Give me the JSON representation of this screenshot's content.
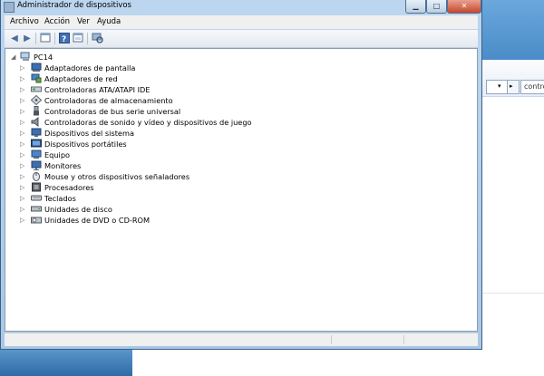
{
  "window": {
    "title": "Administrador de dispositivos",
    "controls": {
      "minimize": "▁",
      "maximize": "□",
      "close": "✕"
    }
  },
  "menubar": {
    "items": [
      "Archivo",
      "Acción",
      "Ver",
      "Ayuda"
    ]
  },
  "toolbar": {
    "buttons": [
      "back-icon",
      "forward-icon",
      "properties-icon",
      "help-icon",
      "console-icon",
      "scan-hardware-icon"
    ]
  },
  "tree": {
    "root": {
      "label": "PC14",
      "icon": "computer-icon"
    },
    "items": [
      {
        "label": "Adaptadores de pantalla",
        "icon": "display-adapter-icon"
      },
      {
        "label": "Adaptadores de red",
        "icon": "network-adapter-icon"
      },
      {
        "label": "Controladoras ATA/ATAPI IDE",
        "icon": "ide-controller-icon"
      },
      {
        "label": "Controladoras de almacenamiento",
        "icon": "storage-controller-icon"
      },
      {
        "label": "Controladoras de bus serie universal",
        "icon": "usb-icon"
      },
      {
        "label": "Controladoras de sonido y vídeo y dispositivos de juego",
        "icon": "speaker-icon"
      },
      {
        "label": "Dispositivos del sistema",
        "icon": "system-device-icon"
      },
      {
        "label": "Dispositivos portátiles",
        "icon": "portable-device-icon"
      },
      {
        "label": "Equipo",
        "icon": "computer-icon"
      },
      {
        "label": "Monitores",
        "icon": "monitor-icon"
      },
      {
        "label": "Mouse y otros dispositivos señaladores",
        "icon": "mouse-icon"
      },
      {
        "label": "Procesadores",
        "icon": "processor-icon"
      },
      {
        "label": "Teclados",
        "icon": "keyboard-icon"
      },
      {
        "label": "Unidades de disco",
        "icon": "disk-drive-icon"
      },
      {
        "label": "Unidades de DVD o CD-ROM",
        "icon": "dvd-drive-icon"
      }
    ]
  },
  "background_window": {
    "field_text": "contro"
  }
}
